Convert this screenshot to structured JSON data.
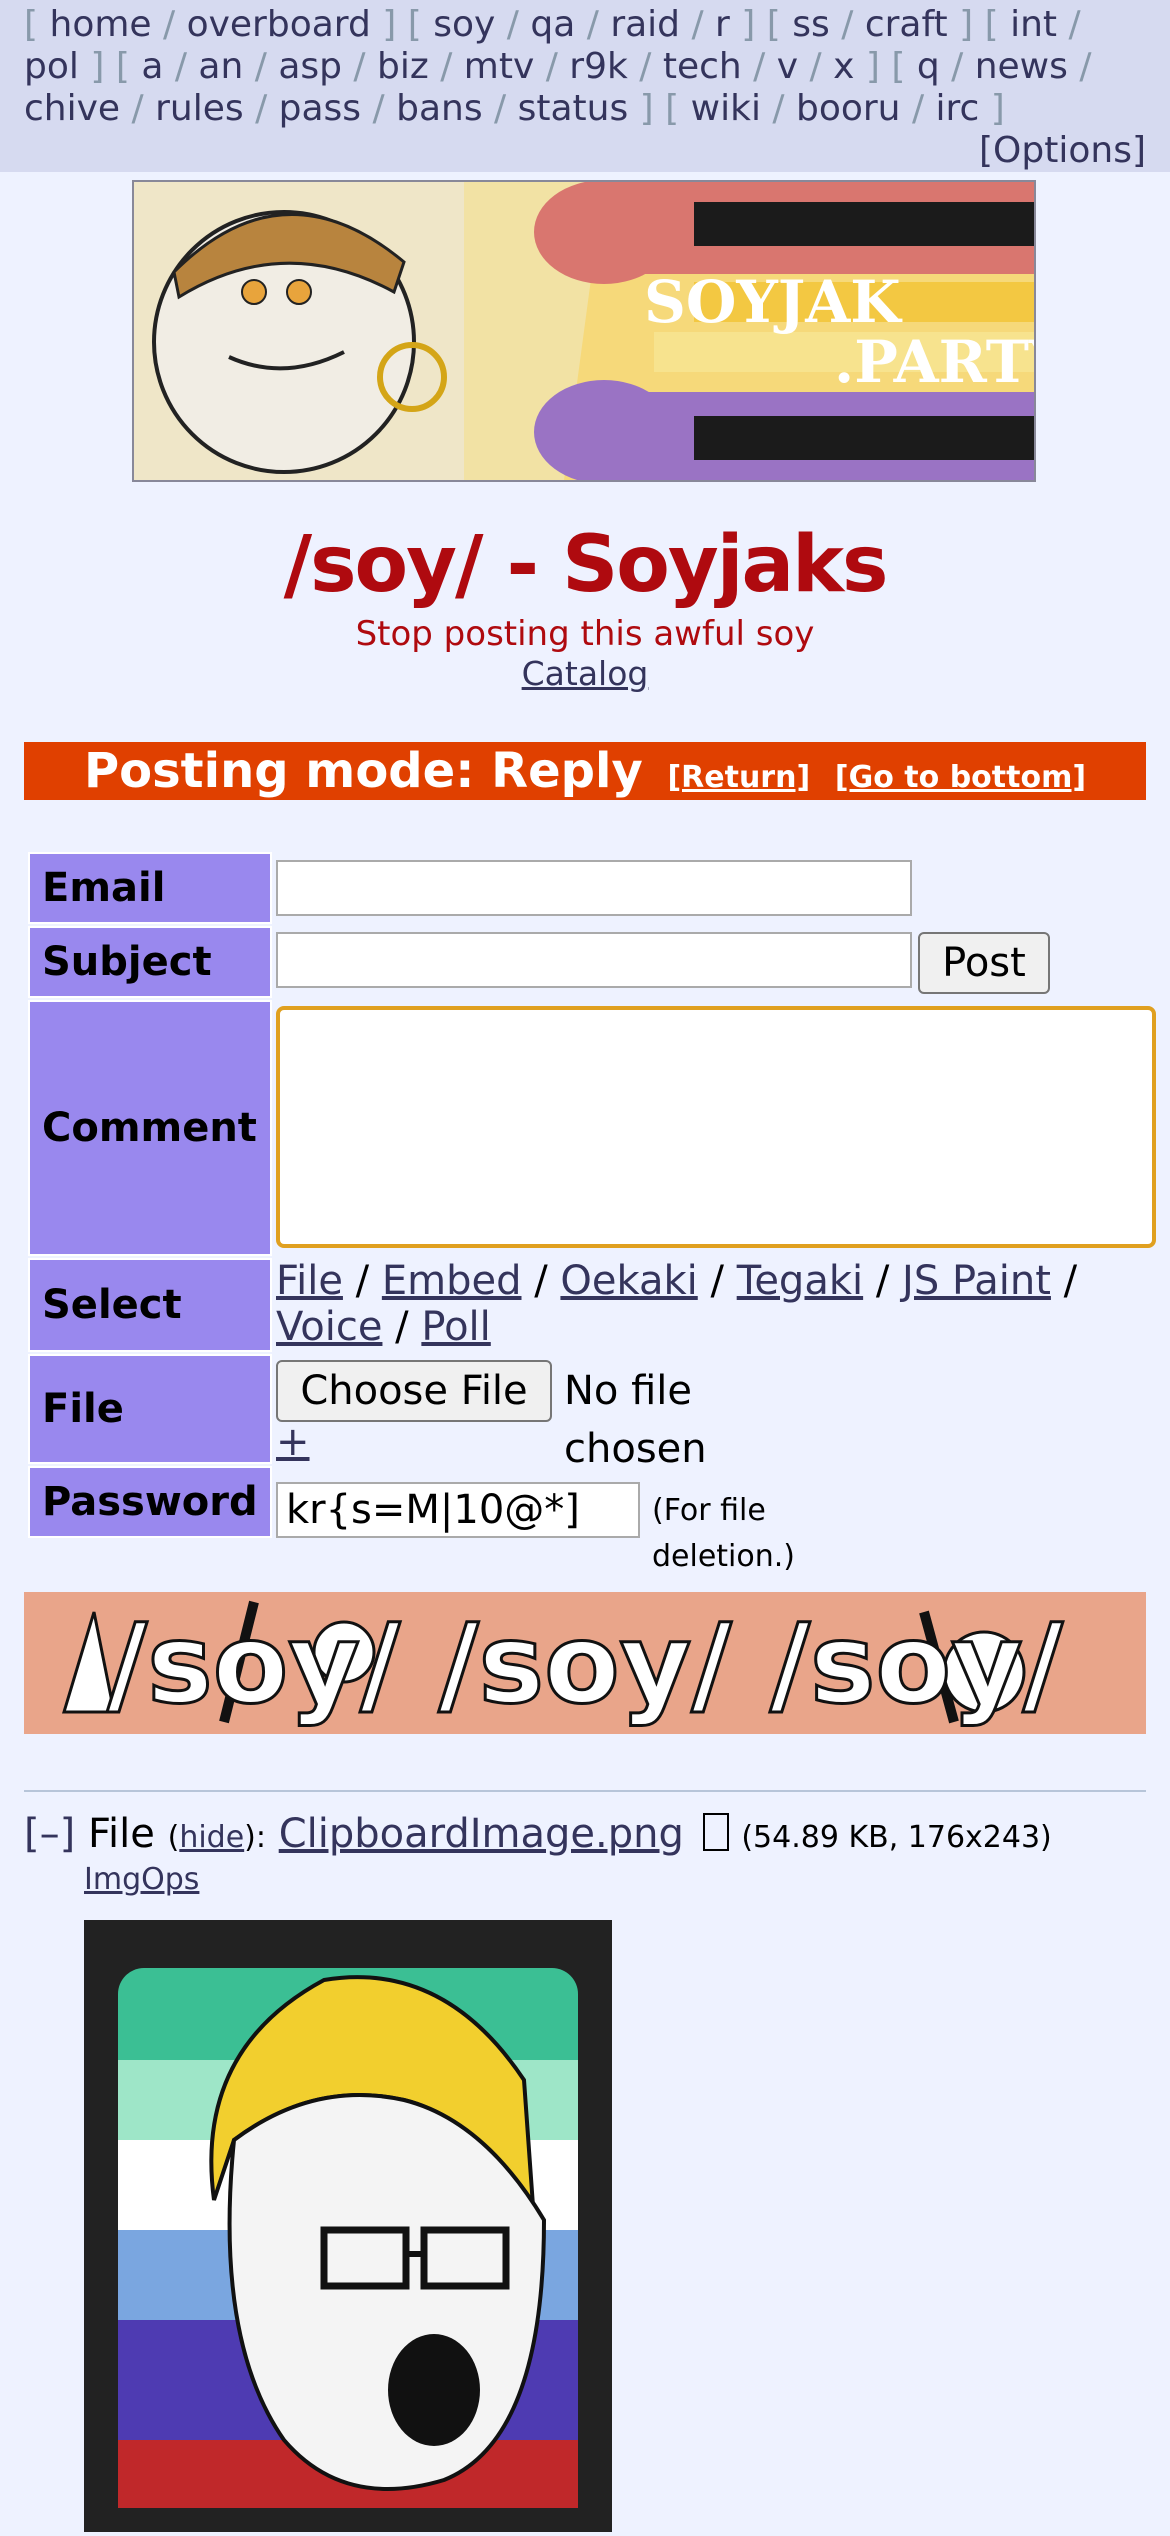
{
  "nav": {
    "groups": [
      [
        "home",
        "overboard"
      ],
      [
        "soy",
        "qa",
        "raid",
        "r"
      ],
      [
        "ss",
        "craft"
      ],
      [
        "int",
        "pol"
      ],
      [
        "a",
        "an",
        "asp",
        "biz",
        "mtv",
        "r9k",
        "tech",
        "v",
        "x"
      ],
      [
        "q",
        "news",
        "chive",
        "rules",
        "pass",
        "bans",
        "status"
      ],
      [
        "wiki",
        "booru",
        "irc"
      ]
    ],
    "options": "[Options]"
  },
  "banner": {
    "text_line1": "SOYJAK",
    "text_line2": ".PARTY"
  },
  "board": {
    "title": "/soy/ - Soyjaks",
    "subtitle": "Stop posting this awful soy",
    "catalog": "Catalog"
  },
  "mode": {
    "title": "Posting mode: Reply",
    "return": "[Return]",
    "bottom": "[Go to bottom]"
  },
  "form": {
    "email_label": "Email",
    "email_value": "",
    "subject_label": "Subject",
    "subject_value": "",
    "post_button": "Post",
    "comment_label": "Comment",
    "select_label": "Select",
    "select_options": [
      "File",
      "Embed",
      "Oekaki",
      "Tegaki",
      "JS Paint",
      "Voice",
      "Poll"
    ],
    "file_label": "File",
    "choose_file": "Choose File",
    "no_file": "No file chosen",
    "add_more": "+",
    "password_label": "Password",
    "password_value": "kr{s=M|10@*]",
    "password_note": "(For file deletion.)"
  },
  "adbanner": {
    "text": "/soy/ /soy/ /soy/"
  },
  "post": {
    "collapse": "[–]",
    "file_prefix": "File",
    "hide": "hide",
    "filename": "ClipboardImage.png",
    "download_icon": "download-icon",
    "meta": "(54.89 KB, 176x243)",
    "imgops": "ImgOps"
  },
  "colors": {
    "accent_red": "#af0a0f",
    "mode_bar": "#e04000",
    "label_bg": "#9988ee",
    "page_bg": "#eef2ff",
    "link": "#34345c"
  }
}
